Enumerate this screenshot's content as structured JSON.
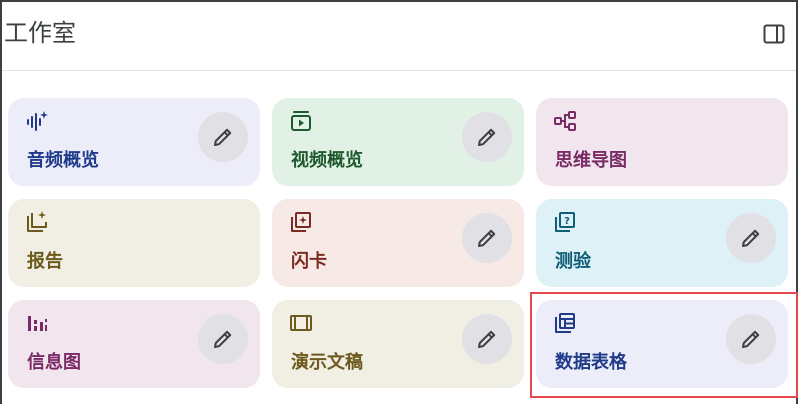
{
  "panel": {
    "title": "工作室",
    "toggle_icon": "dock-right-icon"
  },
  "colors": {
    "blue_bg": "#ecedf8",
    "blue_fg": "#1f3b8a",
    "green_bg": "#e2f1e5",
    "green_fg": "#1f5a2e",
    "pink_bg": "#f1e6ee",
    "pink_fg": "#7a2a66",
    "olive_bg": "#f1efe4",
    "olive_fg": "#6b5a1c",
    "rose_bg": "#f6e9e6",
    "rose_fg": "#7a2c22",
    "cyan_bg": "#ddf1f6",
    "cyan_fg": "#0f5d76",
    "edit_btn_bg": "#e0e0e5",
    "edit_icon": "#3c4043",
    "highlight": "#e5484d"
  },
  "tools": [
    {
      "label": "音频概览",
      "icon": "audio-sparkle-icon",
      "editable": true
    },
    {
      "label": "视频概览",
      "icon": "video-play-icon",
      "editable": true
    },
    {
      "label": "思维导图",
      "icon": "mind-map-icon",
      "editable": false
    },
    {
      "label": "报告",
      "icon": "report-sparkle-icon",
      "editable": false
    },
    {
      "label": "闪卡",
      "icon": "flashcards-icon",
      "editable": true
    },
    {
      "label": "测验",
      "icon": "quiz-icon",
      "editable": true
    },
    {
      "label": "信息图",
      "icon": "infographic-icon",
      "editable": true
    },
    {
      "label": "演示文稿",
      "icon": "slides-icon",
      "editable": true
    },
    {
      "label": "数据表格",
      "icon": "data-table-icon",
      "editable": true
    }
  ],
  "edit_icon": "pencil-icon"
}
